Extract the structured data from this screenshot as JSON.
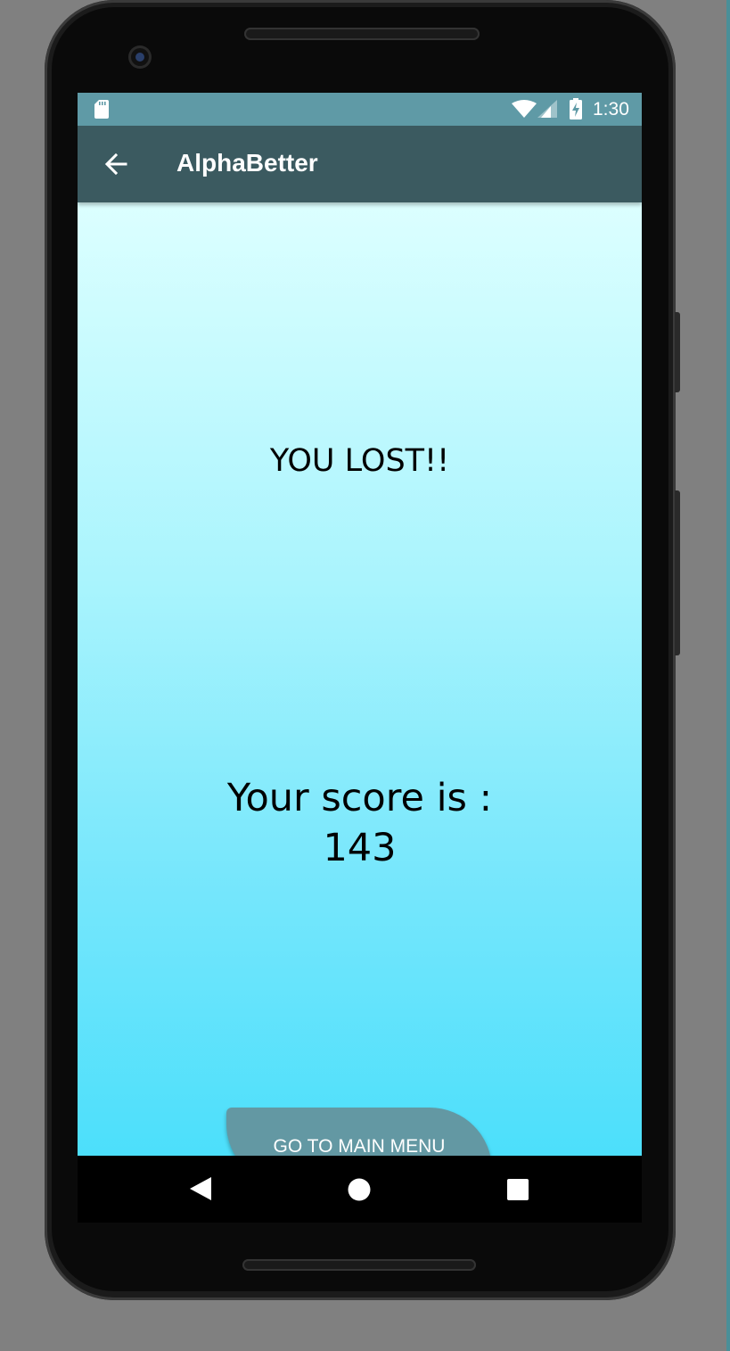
{
  "status_bar": {
    "time": "1:30",
    "icons": [
      "sd-card-icon",
      "wifi-icon",
      "cell-signal-icon",
      "battery-charging-icon"
    ]
  },
  "app_bar": {
    "title": "AlphaBetter",
    "nav_icon": "back-arrow-icon"
  },
  "main": {
    "result_text": "YOU LOST!!",
    "score_label": "Your score is :",
    "score_value": "143",
    "menu_button_label": "GO TO MAIN MENU"
  },
  "nav_bar": {
    "icons": [
      "nav-back-icon",
      "nav-home-icon",
      "nav-recents-icon"
    ]
  },
  "colors": {
    "status_bar": "#5f9aa6",
    "app_bar": "#3b5a60",
    "content_top": "#dcffff",
    "content_bottom": "#4cdffb",
    "button": "#6398a3"
  }
}
